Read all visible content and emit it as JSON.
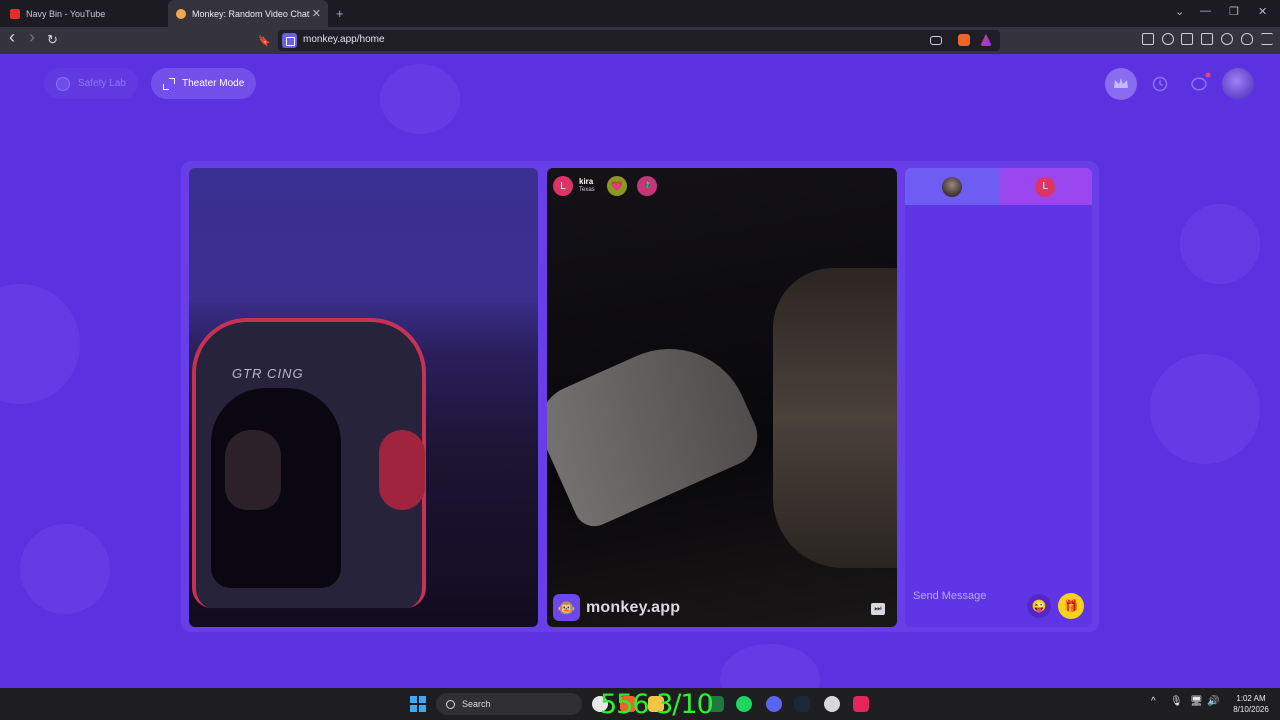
{
  "browser": {
    "tabs": [
      {
        "label": "Navy Bin - YouTube",
        "active": false,
        "favicon_color": "#e52d27"
      },
      {
        "label": "Monkey: Random Video Chat",
        "active": true,
        "favicon_color": "#f2a94a"
      }
    ],
    "close_glyph": "✕",
    "new_tab_glyph": "+",
    "window_controls": [
      "⌄",
      "—",
      "❐",
      "✕"
    ],
    "nav": {
      "back": "‹",
      "forward": "›",
      "reload": "↻",
      "bookmark": "🔖"
    },
    "url": "monkey.app/home"
  },
  "page": {
    "safety_lab_label": "Safety Lab",
    "theater_mode_label": "Theater Mode",
    "header_icons": [
      "crown-icon",
      "history-icon",
      "chat-icon",
      "profile-avatar"
    ],
    "accent": "#5c31e0",
    "local_video": {
      "chair_text": "GTR CING"
    },
    "remote_video": {
      "avatar_letter": "L",
      "user_name": "kira",
      "user_location": "Texas",
      "badges": [
        "💗",
        "🦸"
      ],
      "brand_emoji": "🐵",
      "brand_name": "monkey.app",
      "skip_glyph": "⏭"
    },
    "chat": {
      "tab_letter": "L",
      "input_placeholder": "Send Message",
      "emoji_glyph": "😜",
      "gift_glyph": "🎁"
    }
  },
  "taskbar": {
    "search_label": "Search",
    "overlay_text": "556 3/10",
    "time": "1:02 AM",
    "date": "8/10/2026",
    "tray_glyphs": [
      "^",
      "🎙",
      "🖥",
      "🔊"
    ]
  }
}
